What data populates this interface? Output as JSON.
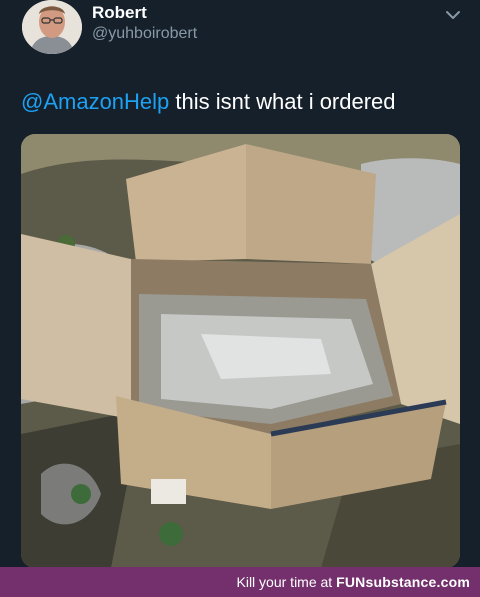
{
  "user": {
    "display_name": "Robert",
    "handle": "@yuhboirobert"
  },
  "tweet": {
    "mention": "@AmazonHelp",
    "text": " this isnt what i ordered"
  },
  "footer": {
    "tagline": "Kill your time at ",
    "brand": "FUNsubstance.com"
  },
  "icons": {
    "menu": "chevron-down-icon",
    "avatar": "profile-photo"
  },
  "colors": {
    "background": "#15202b",
    "mention": "#1da1f2",
    "handle": "#8899a6",
    "footer": "#73306c"
  }
}
